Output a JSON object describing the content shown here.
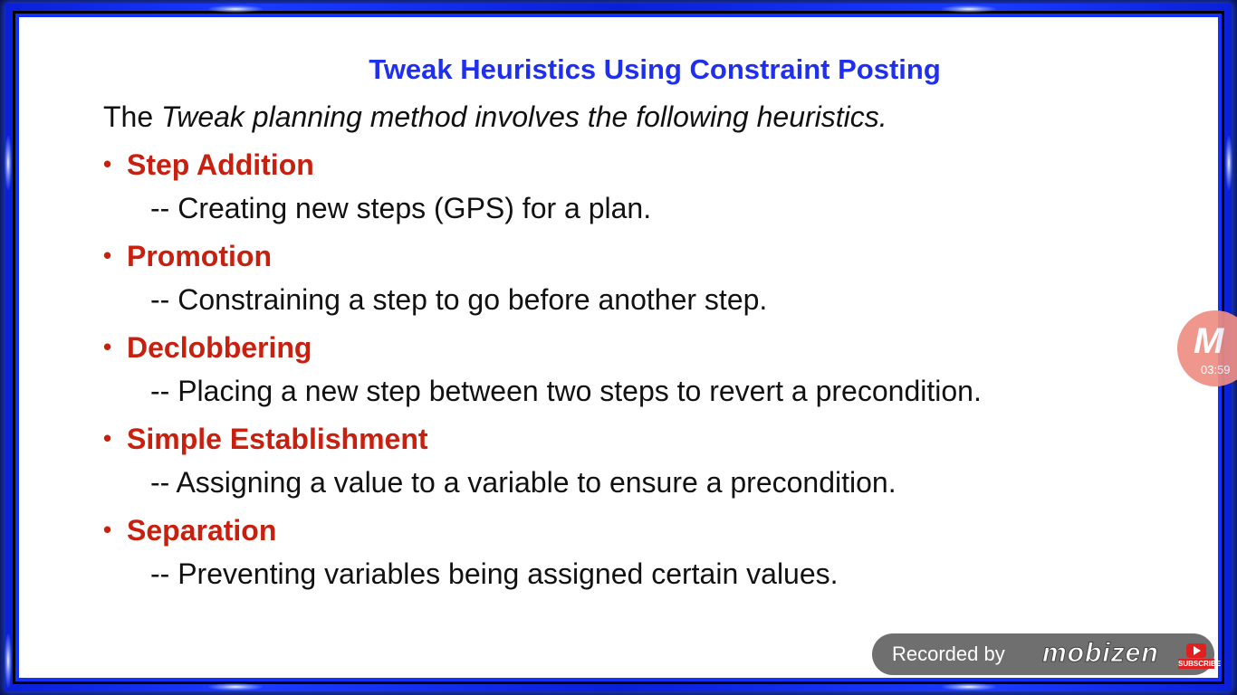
{
  "slide": {
    "title": "Tweak Heuristics Using Constraint Posting",
    "intro_plain": "The ",
    "intro_italic": "Tweak planning method involves the following heuristics.",
    "bullet_glyph": "•",
    "items": [
      {
        "heading": "Step Addition",
        "description": "-- Creating new steps (GPS) for a plan."
      },
      {
        "heading": "Promotion",
        "description": "-- Constraining a step to go before another step."
      },
      {
        "heading": "Declobbering",
        "description": "-- Placing a new step between two steps to revert a precondition."
      },
      {
        "heading": "Simple Establishment",
        "description": "-- Assigning a value to a variable to ensure a precondition."
      },
      {
        "heading": "Separation",
        "description": "-- Preventing variables being assigned certain values."
      }
    ]
  },
  "overlay": {
    "bubble_glyph": "M",
    "bubble_time": "03:59",
    "recorded_by": "Recorded by",
    "brand": "mobizen",
    "subscribe_label": "SUBSCRIBE"
  },
  "colors": {
    "title": "#1f2ff0",
    "heading": "#c8200f",
    "body_text": "#111111",
    "frame": "#1230ff",
    "bubble": "#ef8f84"
  },
  "icons": {
    "bubble": "mobizen-logo-icon",
    "subscribe": "youtube-play-icon"
  }
}
